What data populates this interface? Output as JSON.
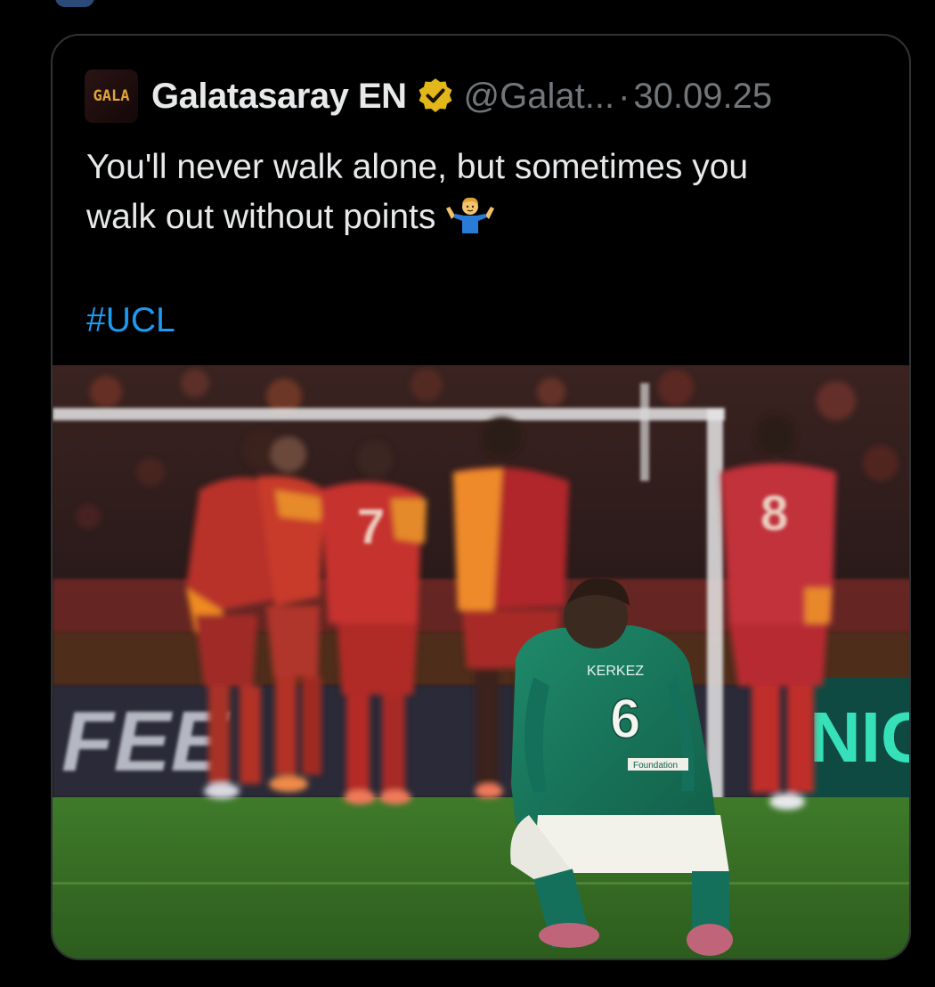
{
  "quoted_tweet": {
    "avatar_text": "GALA",
    "author_name": "Galatasaray EN",
    "handle": "@Galat...",
    "separator": "·",
    "date": "30.09.25",
    "text_line_1": "You'll never walk alone, but sometimes you",
    "text_line_2": "walk out without points",
    "emoji": "man-shrugging-emoji",
    "hashtag": "#UCL",
    "media": {
      "type": "photo",
      "description_icon": "football-match-photo",
      "jersey_numbers": [
        "7",
        "8",
        "6"
      ],
      "player_name_on_shirt": "KERKEZ",
      "sleeve_text": "Foundation",
      "board_text_left": "FEE",
      "board_text_right": "NIG"
    }
  },
  "colors": {
    "background": "#000000",
    "border": "#2f3336",
    "text_primary": "#e7e9ea",
    "text_secondary": "#71767b",
    "link": "#1d9bf0",
    "verified_gold": "#e2b719"
  }
}
